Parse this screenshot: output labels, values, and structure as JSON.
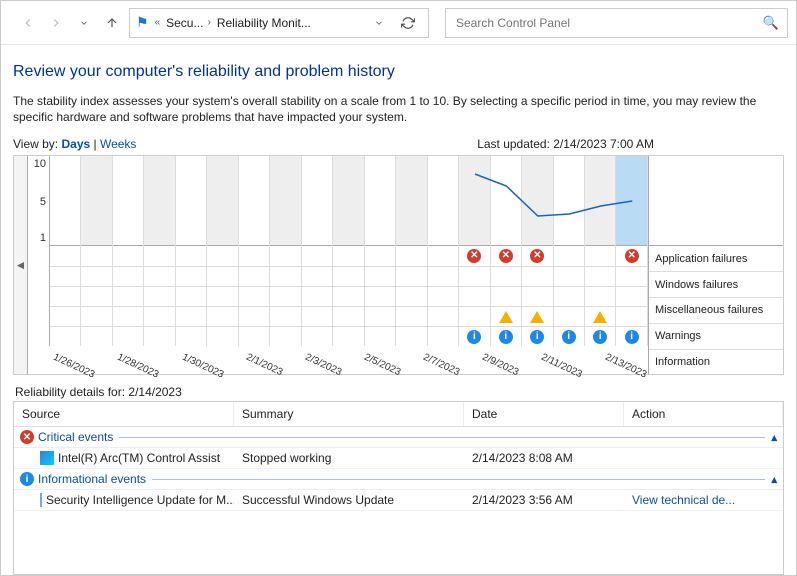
{
  "toolbar": {
    "breadcrumb": [
      "Secu...",
      "Reliability Monit..."
    ],
    "search_placeholder": "Search Control Panel"
  },
  "page": {
    "title": "Review your computer's reliability and problem history",
    "description": "The stability index assesses your system's overall stability on a scale from 1 to 10. By selecting a specific period in time, you may review the specific hardware and software problems that have impacted your system.",
    "view_by_label": "View by:",
    "view_days": "Days",
    "view_weeks": "Weeks",
    "last_updated": "Last updated: 2/14/2023 7:00 AM"
  },
  "chart_data": {
    "type": "line",
    "ylim": [
      1,
      10
    ],
    "yticks": [
      10,
      5,
      1
    ],
    "dates": [
      "1/26/2023",
      "1/28/2023",
      "1/30/2023",
      "2/1/2023",
      "2/3/2023",
      "2/5/2023",
      "2/7/2023",
      "2/9/2023",
      "2/11/2023",
      "2/13/2023"
    ],
    "columns": 19,
    "selected_index": 18,
    "stability": [
      null,
      null,
      null,
      null,
      null,
      null,
      null,
      null,
      null,
      null,
      null,
      null,
      null,
      8.2,
      7.0,
      4.0,
      4.2,
      5.0,
      5.5
    ],
    "event_rows": [
      "Application failures",
      "Windows failures",
      "Miscellaneous failures",
      "Warnings",
      "Information"
    ],
    "events": {
      "app_fail": [
        0,
        0,
        0,
        0,
        0,
        0,
        0,
        0,
        0,
        0,
        0,
        0,
        0,
        1,
        1,
        1,
        0,
        0,
        1
      ],
      "win_fail": [
        0,
        0,
        0,
        0,
        0,
        0,
        0,
        0,
        0,
        0,
        0,
        0,
        0,
        0,
        0,
        0,
        0,
        0,
        0
      ],
      "misc_fail": [
        0,
        0,
        0,
        0,
        0,
        0,
        0,
        0,
        0,
        0,
        0,
        0,
        0,
        0,
        0,
        0,
        0,
        0,
        0
      ],
      "warnings": [
        0,
        0,
        0,
        0,
        0,
        0,
        0,
        0,
        0,
        0,
        0,
        0,
        0,
        0,
        1,
        1,
        0,
        1,
        0
      ],
      "info": [
        0,
        0,
        0,
        0,
        0,
        0,
        0,
        0,
        0,
        0,
        0,
        0,
        0,
        1,
        1,
        1,
        1,
        1,
        1
      ]
    }
  },
  "details": {
    "title_prefix": "Reliability details for:",
    "title_date": "2/14/2023",
    "columns": {
      "source": "Source",
      "summary": "Summary",
      "date": "Date",
      "action": "Action"
    },
    "groups": [
      {
        "name": "Critical events",
        "icon": "error",
        "rows": [
          {
            "source": "Intel(R) Arc(TM) Control Assist",
            "summary": "Stopped working",
            "date": "2/14/2023 8:08 AM",
            "action": ""
          }
        ]
      },
      {
        "name": "Informational events",
        "icon": "info",
        "rows": [
          {
            "source": "Security Intelligence Update for M...",
            "summary": "Successful Windows Update",
            "date": "2/14/2023 3:56 AM",
            "action": "View technical de..."
          }
        ]
      }
    ]
  }
}
